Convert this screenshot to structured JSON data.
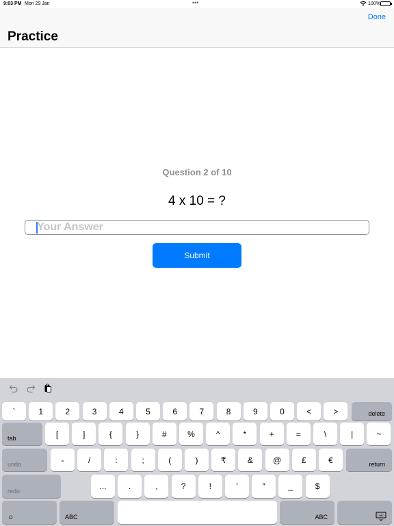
{
  "status": {
    "time": "9:03 PM",
    "date": "Mon 29 Jan",
    "dots": "•••",
    "battery_pct": "100%"
  },
  "nav": {
    "done": "Done",
    "title": "Practice"
  },
  "main": {
    "counter": "Question 2 of 10",
    "equation": "4 x 10 = ?",
    "answer_placeholder": "Your Answer",
    "answer_value": "",
    "submit": "Submit"
  },
  "keyboard": {
    "row1": [
      "`",
      "1",
      "2",
      "3",
      "4",
      "5",
      "6",
      "7",
      "8",
      "9",
      "0",
      "<",
      ">"
    ],
    "delete": "delete",
    "tab": "tab",
    "row2": [
      "[",
      "]",
      "{",
      "}",
      "#",
      "%",
      "^",
      "*",
      "+",
      "=",
      "\\",
      "|",
      "~"
    ],
    "undo": "undo",
    "row3": [
      "-",
      "/",
      ":",
      ";",
      "(",
      ")",
      "₹",
      "&",
      "@",
      "£",
      "€"
    ],
    "return": "return",
    "redo": "redo",
    "row4": [
      "...",
      ".",
      ",",
      "?",
      "!",
      "′",
      "″",
      "_",
      "$"
    ],
    "emoji_glyph": "☺",
    "abc_left": "ABC",
    "abc_right": "ABC"
  }
}
